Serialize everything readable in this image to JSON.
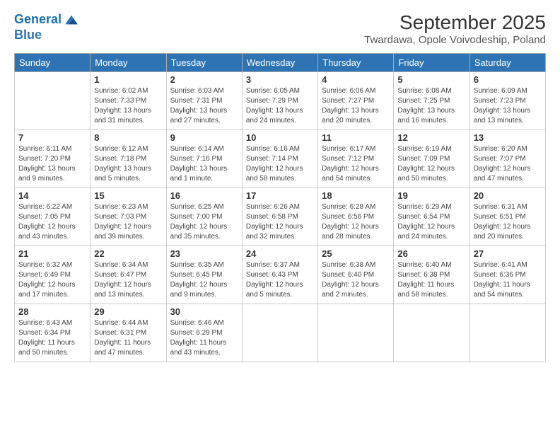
{
  "logo": {
    "line1": "General",
    "line2": "Blue"
  },
  "title": "September 2025",
  "subtitle": "Twardawa, Opole Voivodeship, Poland",
  "days_of_week": [
    "Sunday",
    "Monday",
    "Tuesday",
    "Wednesday",
    "Thursday",
    "Friday",
    "Saturday"
  ],
  "weeks": [
    [
      {
        "day": "",
        "info": ""
      },
      {
        "day": "1",
        "info": "Sunrise: 6:02 AM\nSunset: 7:33 PM\nDaylight: 13 hours\nand 31 minutes."
      },
      {
        "day": "2",
        "info": "Sunrise: 6:03 AM\nSunset: 7:31 PM\nDaylight: 13 hours\nand 27 minutes."
      },
      {
        "day": "3",
        "info": "Sunrise: 6:05 AM\nSunset: 7:29 PM\nDaylight: 13 hours\nand 24 minutes."
      },
      {
        "day": "4",
        "info": "Sunrise: 6:06 AM\nSunset: 7:27 PM\nDaylight: 13 hours\nand 20 minutes."
      },
      {
        "day": "5",
        "info": "Sunrise: 6:08 AM\nSunset: 7:25 PM\nDaylight: 13 hours\nand 16 minutes."
      },
      {
        "day": "6",
        "info": "Sunrise: 6:09 AM\nSunset: 7:23 PM\nDaylight: 13 hours\nand 13 minutes."
      }
    ],
    [
      {
        "day": "7",
        "info": "Sunrise: 6:11 AM\nSunset: 7:20 PM\nDaylight: 13 hours\nand 9 minutes."
      },
      {
        "day": "8",
        "info": "Sunrise: 6:12 AM\nSunset: 7:18 PM\nDaylight: 13 hours\nand 5 minutes."
      },
      {
        "day": "9",
        "info": "Sunrise: 6:14 AM\nSunset: 7:16 PM\nDaylight: 13 hours\nand 1 minute."
      },
      {
        "day": "10",
        "info": "Sunrise: 6:16 AM\nSunset: 7:14 PM\nDaylight: 12 hours\nand 58 minutes."
      },
      {
        "day": "11",
        "info": "Sunrise: 6:17 AM\nSunset: 7:12 PM\nDaylight: 12 hours\nand 54 minutes."
      },
      {
        "day": "12",
        "info": "Sunrise: 6:19 AM\nSunset: 7:09 PM\nDaylight: 12 hours\nand 50 minutes."
      },
      {
        "day": "13",
        "info": "Sunrise: 6:20 AM\nSunset: 7:07 PM\nDaylight: 12 hours\nand 47 minutes."
      }
    ],
    [
      {
        "day": "14",
        "info": "Sunrise: 6:22 AM\nSunset: 7:05 PM\nDaylight: 12 hours\nand 43 minutes."
      },
      {
        "day": "15",
        "info": "Sunrise: 6:23 AM\nSunset: 7:03 PM\nDaylight: 12 hours\nand 39 minutes."
      },
      {
        "day": "16",
        "info": "Sunrise: 6:25 AM\nSunset: 7:00 PM\nDaylight: 12 hours\nand 35 minutes."
      },
      {
        "day": "17",
        "info": "Sunrise: 6:26 AM\nSunset: 6:58 PM\nDaylight: 12 hours\nand 32 minutes."
      },
      {
        "day": "18",
        "info": "Sunrise: 6:28 AM\nSunset: 6:56 PM\nDaylight: 12 hours\nand 28 minutes."
      },
      {
        "day": "19",
        "info": "Sunrise: 6:29 AM\nSunset: 6:54 PM\nDaylight: 12 hours\nand 24 minutes."
      },
      {
        "day": "20",
        "info": "Sunrise: 6:31 AM\nSunset: 6:51 PM\nDaylight: 12 hours\nand 20 minutes."
      }
    ],
    [
      {
        "day": "21",
        "info": "Sunrise: 6:32 AM\nSunset: 6:49 PM\nDaylight: 12 hours\nand 17 minutes."
      },
      {
        "day": "22",
        "info": "Sunrise: 6:34 AM\nSunset: 6:47 PM\nDaylight: 12 hours\nand 13 minutes."
      },
      {
        "day": "23",
        "info": "Sunrise: 6:35 AM\nSunset: 6:45 PM\nDaylight: 12 hours\nand 9 minutes."
      },
      {
        "day": "24",
        "info": "Sunrise: 6:37 AM\nSunset: 6:43 PM\nDaylight: 12 hours\nand 5 minutes."
      },
      {
        "day": "25",
        "info": "Sunrise: 6:38 AM\nSunset: 6:40 PM\nDaylight: 12 hours\nand 2 minutes."
      },
      {
        "day": "26",
        "info": "Sunrise: 6:40 AM\nSunset: 6:38 PM\nDaylight: 11 hours\nand 58 minutes."
      },
      {
        "day": "27",
        "info": "Sunrise: 6:41 AM\nSunset: 6:36 PM\nDaylight: 11 hours\nand 54 minutes."
      }
    ],
    [
      {
        "day": "28",
        "info": "Sunrise: 6:43 AM\nSunset: 6:34 PM\nDaylight: 11 hours\nand 50 minutes."
      },
      {
        "day": "29",
        "info": "Sunrise: 6:44 AM\nSunset: 6:31 PM\nDaylight: 11 hours\nand 47 minutes."
      },
      {
        "day": "30",
        "info": "Sunrise: 6:46 AM\nSunset: 6:29 PM\nDaylight: 11 hours\nand 43 minutes."
      },
      {
        "day": "",
        "info": ""
      },
      {
        "day": "",
        "info": ""
      },
      {
        "day": "",
        "info": ""
      },
      {
        "day": "",
        "info": ""
      }
    ]
  ]
}
